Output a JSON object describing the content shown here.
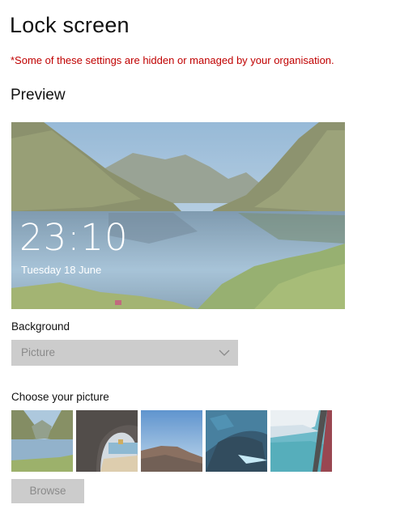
{
  "page": {
    "title": "Lock screen",
    "managed_note": "*Some of these settings are hidden or managed by your organisation."
  },
  "preview": {
    "section_title": "Preview",
    "time": "23:10",
    "date": "Tuesday 18 June"
  },
  "background": {
    "label": "Background",
    "selected": "Picture",
    "disabled": true
  },
  "picture_chooser": {
    "label": "Choose your picture",
    "thumbnails": [
      {
        "name": "fjord-lake"
      },
      {
        "name": "sea-cave-beach"
      },
      {
        "name": "hill-under-sky"
      },
      {
        "name": "ice-cave"
      },
      {
        "name": "aerial-coast"
      }
    ],
    "browse_label": "Browse"
  },
  "colors": {
    "managed_note": "#c00000",
    "disabled_control": "#cccccc",
    "disabled_text": "#8a8a8a"
  }
}
